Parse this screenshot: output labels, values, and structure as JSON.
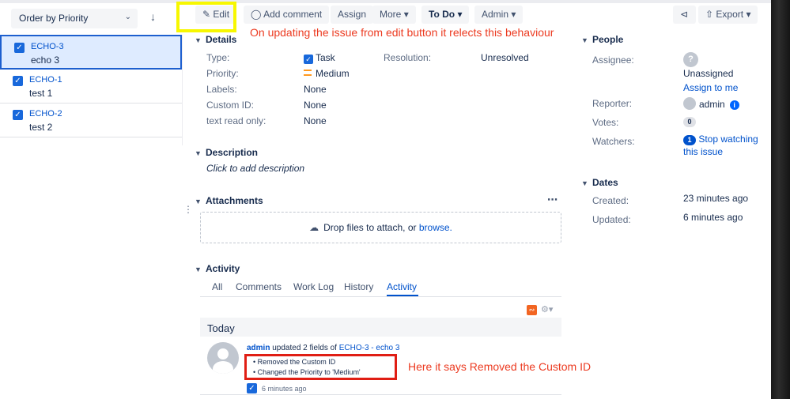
{
  "left_panel": {
    "order_label": "Order by Priority",
    "issues": [
      {
        "key": "ECHO-3",
        "summary": "echo 3"
      },
      {
        "key": "ECHO-1",
        "summary": "test 1"
      },
      {
        "key": "ECHO-2",
        "summary": "test 2"
      }
    ]
  },
  "toolbar": {
    "edit": "Edit",
    "add_comment": "Add comment",
    "assign": "Assign",
    "more": "More",
    "status": "To Do",
    "admin": "Admin",
    "export": "Export"
  },
  "annotations": {
    "top_note": "On updating the issue from edit button it relects this behaviour",
    "activity_note": "Here it says Removed the Custom ID"
  },
  "details": {
    "heading": "Details",
    "type_label": "Type:",
    "type_value": "Task",
    "priority_label": "Priority:",
    "priority_value": "Medium",
    "labels_label": "Labels:",
    "labels_value": "None",
    "custom_id_label": "Custom ID:",
    "custom_id_value": "None",
    "text_ro_label": "text read only:",
    "text_ro_value": "None",
    "resolution_label": "Resolution:",
    "resolution_value": "Unresolved"
  },
  "description": {
    "heading": "Description",
    "placeholder": "Click to add description"
  },
  "attachments": {
    "heading": "Attachments",
    "drop_text": "Drop files to attach, or",
    "browse": "browse."
  },
  "activity": {
    "heading": "Activity",
    "tabs": [
      "All",
      "Comments",
      "Work Log",
      "History",
      "Activity"
    ],
    "active_tab": "Activity",
    "today": "Today",
    "actor": "admin",
    "action": "updated 2 fields of",
    "issue_link": "ECHO-3 - echo 3",
    "changes": [
      "Removed the Custom ID",
      "Changed the Priority to 'Medium'"
    ],
    "time": "6 minutes ago"
  },
  "people": {
    "heading": "People",
    "assignee_label": "Assignee:",
    "assignee_value": "Unassigned",
    "assign_to_me": "Assign to me",
    "reporter_label": "Reporter:",
    "reporter_value": "admin",
    "votes_label": "Votes:",
    "votes_value": "0",
    "watchers_label": "Watchers:",
    "watchers_count": "1",
    "stop_watching_1": "Stop watching",
    "stop_watching_2": "this issue"
  },
  "dates": {
    "heading": "Dates",
    "created_label": "Created:",
    "created_value": "23 minutes ago",
    "updated_label": "Updated:",
    "updated_value": "6 minutes ago"
  },
  "colors": {
    "accent": "#0052cc",
    "highlight_yellow": "#f7f700",
    "annotation_red": "#ec3a20",
    "priority_medium": "#ff991f"
  }
}
